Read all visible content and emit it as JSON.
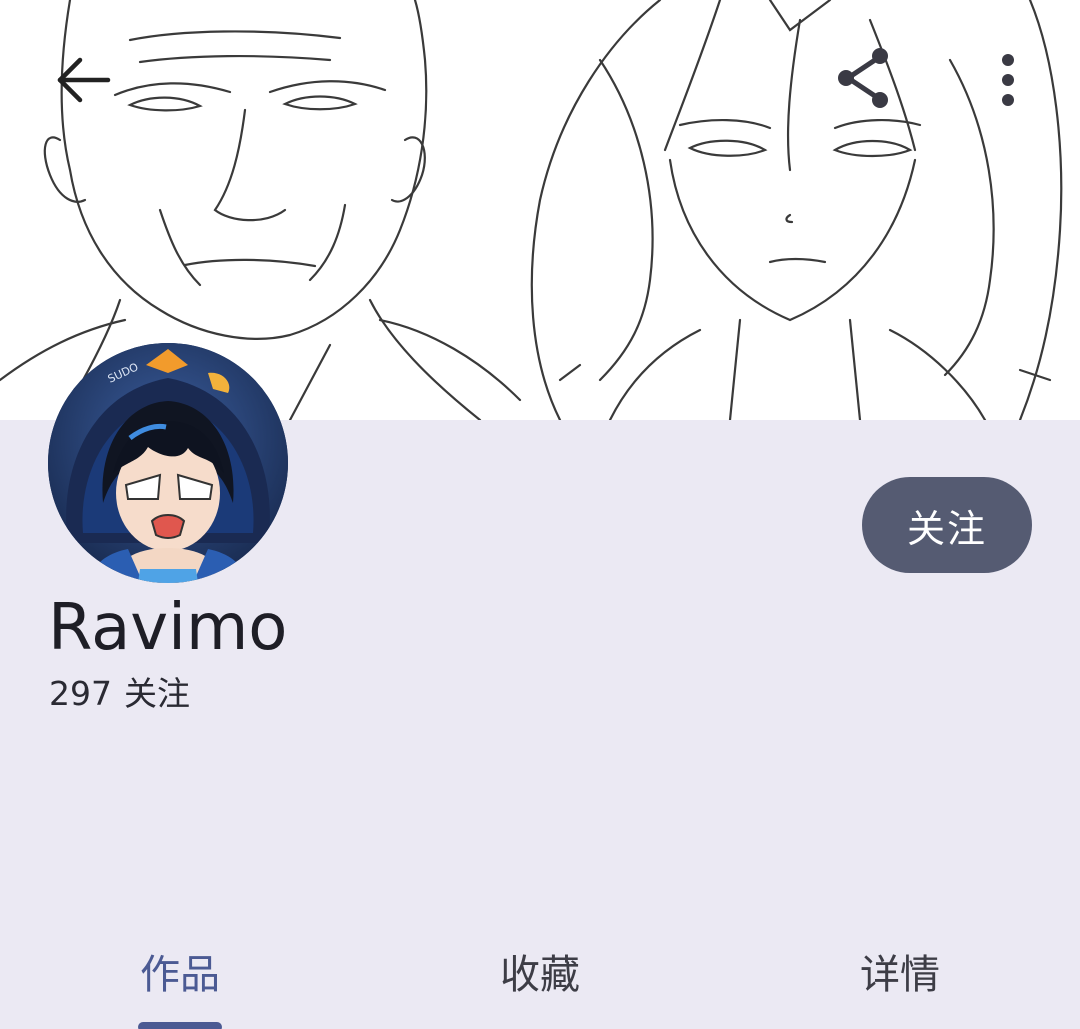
{
  "profile": {
    "username": "Ravimo",
    "following_count": "297",
    "following_label": "关注",
    "follow_button": "关注"
  },
  "toolbar": {
    "back_icon": "arrow-left-icon",
    "share_icon": "share-icon",
    "more_icon": "more-vertical-icon"
  },
  "tabs": [
    {
      "label": "作品",
      "active": true
    },
    {
      "label": "收藏",
      "active": false
    },
    {
      "label": "详情",
      "active": false
    }
  ],
  "colors": {
    "background": "#EBE9F3",
    "follow_button": "#555B72",
    "active_tab": "#4B5A93"
  }
}
